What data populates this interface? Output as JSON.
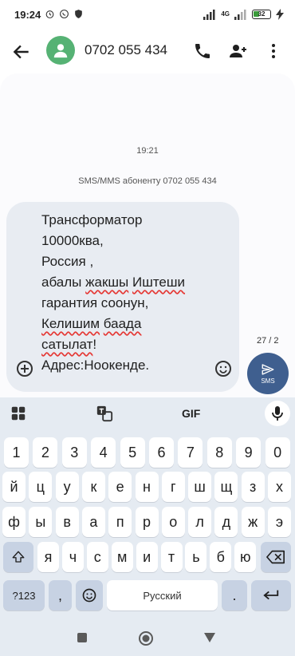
{
  "status": {
    "time": "19:24",
    "network": "4G",
    "battery": "32"
  },
  "header": {
    "contact_name": "0702 055 434"
  },
  "conversation": {
    "timestamp": "19:21",
    "sms_label": "SMS/MMS абоненту 0702 055 434"
  },
  "compose": {
    "lines": [
      [
        "Трансформатор"
      ],
      [
        "10000ква,"
      ],
      [
        "Россия ,"
      ],
      [
        "абалы ",
        {
          "w": "жакшы"
        },
        " ",
        {
          "w": "Иштеши"
        }
      ],
      [
        "гарантия соонун,"
      ],
      [
        {
          "w": "Келишим"
        },
        " ",
        {
          "w": "баада"
        }
      ],
      [
        {
          "w": "сатылат"
        },
        "!"
      ],
      [
        "Адрес:Ноокенде."
      ]
    ],
    "counter": "27 / 2",
    "send_label": "SMS"
  },
  "keyboard": {
    "gif_label": "GIF",
    "numbers": [
      "1",
      "2",
      "3",
      "4",
      "5",
      "6",
      "7",
      "8",
      "9",
      "0"
    ],
    "row1": [
      "й",
      "ц",
      "у",
      "к",
      "е",
      "н",
      "г",
      "ш",
      "щ",
      "з",
      "х"
    ],
    "row2": [
      "ф",
      "ы",
      "в",
      "а",
      "п",
      "р",
      "о",
      "л",
      "д",
      "ж",
      "э"
    ],
    "row3": [
      "я",
      "ч",
      "с",
      "м",
      "и",
      "т",
      "ь",
      "б",
      "ю"
    ],
    "symbols_label": "?123",
    "comma": ",",
    "period": ".",
    "space_label": "Русский"
  },
  "colors": {
    "accent": "#3f5f8f",
    "avatar": "#56b274",
    "spell_error": "#e53935"
  }
}
